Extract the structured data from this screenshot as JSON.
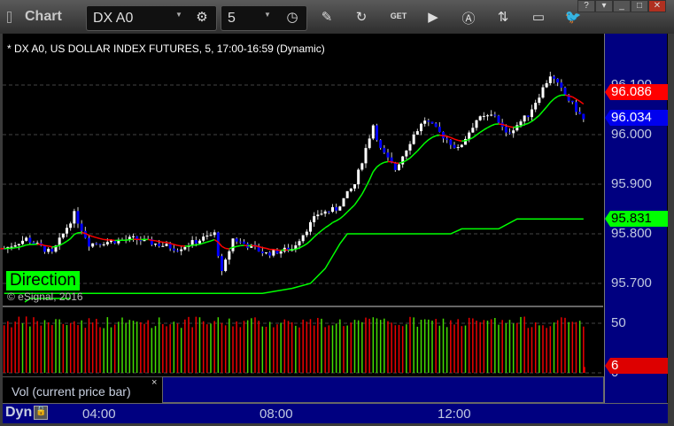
{
  "window": {
    "title": "Chart",
    "symbol": "DX A0",
    "interval": "5",
    "help": "?"
  },
  "toolbar_icons": [
    "gear-icon",
    "clock-icon",
    "pencil-icon",
    "refresh-chart-icon",
    "get-icon",
    "play-icon",
    "alert-icon",
    "link-icon",
    "comment-icon",
    "twitter-icon"
  ],
  "toolbar_get_label": "GET",
  "chart": {
    "header": "* DX A0, US DOLLAR INDEX FUTURES, 5, 17:00-16:59 (Dynamic)",
    "direction_label": "Direction",
    "copyright": "© eSignal, 2016",
    "price_labels": [
      "96.100",
      "96.000",
      "95.900",
      "95.800",
      "95.700"
    ],
    "tags": {
      "red": "96.086",
      "blue": "96.034",
      "green": "95.831"
    },
    "volume_labels": [
      "50",
      "0"
    ],
    "volume_tag": "6",
    "volume_legend": "Vol (current price bar)",
    "close_x": "×",
    "dyn_label": "Dyn",
    "time_labels": [
      "04:00",
      "08:00",
      "12:00"
    ]
  },
  "chart_data": {
    "type": "candlestick",
    "price_axis": [
      95.7,
      96.1
    ],
    "price_path": [
      [
        "01:50",
        95.77
      ],
      [
        "02:20",
        95.79
      ],
      [
        "02:55",
        95.76
      ],
      [
        "03:25",
        95.84
      ],
      [
        "03:45",
        95.78
      ],
      [
        "04:45",
        95.79
      ],
      [
        "05:45",
        95.77
      ],
      [
        "06:35",
        95.8
      ],
      [
        "06:45",
        95.72
      ],
      [
        "07:00",
        95.79
      ],
      [
        "07:45",
        95.76
      ],
      [
        "08:20",
        95.77
      ],
      [
        "08:55",
        95.84
      ],
      [
        "09:20",
        95.85
      ],
      [
        "09:45",
        95.9
      ],
      [
        "10:10",
        96.02
      ],
      [
        "10:20",
        95.97
      ],
      [
        "10:40",
        95.93
      ],
      [
        "11:05",
        96.0
      ],
      [
        "11:20",
        96.03
      ],
      [
        "12:05",
        95.97
      ],
      [
        "12:30",
        96.03
      ],
      [
        "12:55",
        96.04
      ],
      [
        "13:10",
        96.0
      ],
      [
        "13:40",
        96.04
      ],
      [
        "14:10",
        96.12
      ],
      [
        "14:30",
        96.08
      ],
      [
        "14:55",
        96.03
      ]
    ],
    "stop_line": [
      [
        "01:50",
        95.68
      ],
      [
        "07:40",
        95.68
      ],
      [
        "08:20",
        95.69
      ],
      [
        "08:45",
        95.7
      ],
      [
        "09:05",
        95.73
      ],
      [
        "09:25",
        95.78
      ],
      [
        "09:35",
        95.8
      ],
      [
        "11:55",
        95.8
      ],
      [
        "12:10",
        95.81
      ],
      [
        "13:00",
        95.81
      ],
      [
        "13:25",
        95.83
      ],
      [
        "14:55",
        95.83
      ]
    ],
    "volume_axis": [
      0,
      50
    ],
    "last_volume": 6,
    "colors": {
      "up_candle": "#ffffff",
      "down_candle": "#0000ff",
      "ma_up": "#00ff00",
      "ma_down": "#ff0000",
      "vol_up": "#44dd00",
      "vol_down": "#ee0000",
      "axis_bg": "#000080"
    }
  }
}
